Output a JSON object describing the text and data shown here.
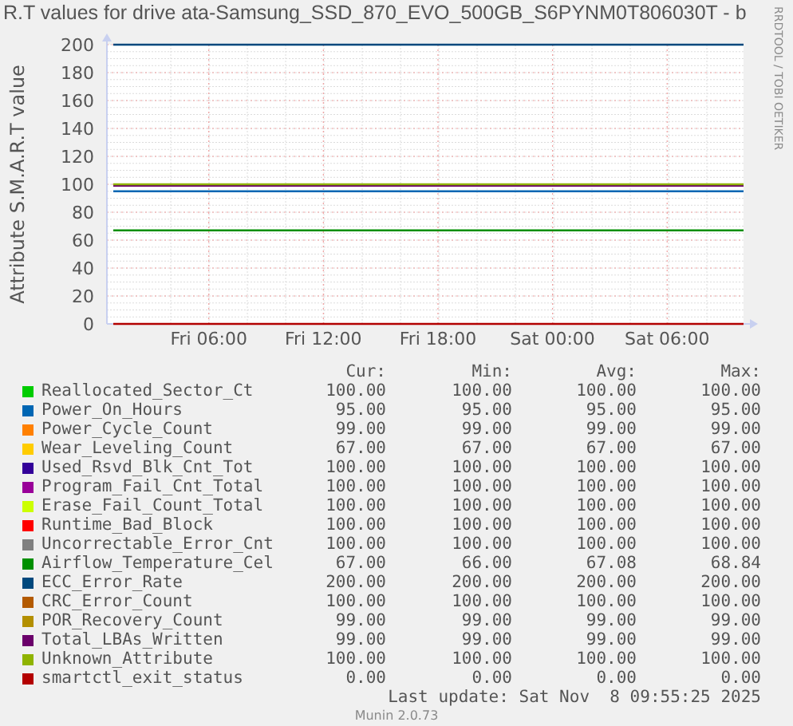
{
  "title": "R.T values for drive ata-Samsung_SSD_870_EVO_500GB_S6PYNM0T806030T - b",
  "side_text": "RRDTOOL / TOBI OETIKER",
  "chart": {
    "chart_data": {
      "type": "line",
      "ylabel": "Attribute S.M.A.R.T value",
      "categories": [
        null,
        null,
        null,
        null,
        null,
        "Fri 06:00",
        null,
        null,
        null,
        null,
        null,
        "Fri 12:00",
        null,
        null,
        null,
        null,
        null,
        "Fri 18:00",
        null,
        null,
        null,
        null,
        null,
        "Sat 00:00",
        null,
        null,
        null,
        null,
        null,
        "Sat 06:00",
        null,
        null,
        null,
        null
      ],
      "grid": true,
      "ylim": [
        0,
        200
      ],
      "yticks": [
        0,
        20,
        40,
        60,
        80,
        100,
        120,
        140,
        160,
        180,
        200
      ],
      "series": [
        {
          "name": "Reallocated_Sector_Ct",
          "color": "#00cc00",
          "values": [
            null,
            null,
            null,
            null,
            null,
            null,
            null,
            null,
            null,
            null,
            null,
            null,
            null,
            null,
            null,
            null,
            null,
            null,
            null,
            null,
            null,
            null,
            null,
            null,
            null,
            null,
            null,
            null,
            null,
            null,
            null,
            null,
            null,
            null
          ]
        },
        {
          "name": "Power_On_Hours",
          "color": "#0066b3",
          "values": [
            95,
            95,
            95,
            95,
            95,
            95,
            95,
            95,
            95,
            95,
            95,
            95,
            95,
            95,
            95,
            95,
            95,
            95,
            95,
            95,
            95,
            95,
            95,
            95,
            95,
            95,
            95,
            95,
            95,
            95,
            95,
            95,
            95,
            95
          ]
        },
        {
          "name": "Power_Cycle_Count",
          "color": "#ff8000",
          "values": [
            null,
            null,
            null,
            null,
            null,
            null,
            null,
            null,
            null,
            null,
            null,
            null,
            null,
            null,
            null,
            null,
            null,
            null,
            null,
            null,
            null,
            null,
            null,
            null,
            null,
            null,
            null,
            null,
            null,
            null,
            null,
            null,
            null,
            null
          ]
        },
        {
          "name": "Wear_Leveling_Count",
          "color": "#ffcc00",
          "values": [
            null,
            null,
            null,
            null,
            null,
            null,
            null,
            null,
            null,
            null,
            null,
            null,
            null,
            null,
            null,
            null,
            null,
            null,
            null,
            null,
            null,
            null,
            null,
            null,
            null,
            null,
            null,
            null,
            null,
            null,
            null,
            null,
            null,
            null
          ]
        },
        {
          "name": "Used_Rsvd_Blk_Cnt_Tot",
          "color": "#330099",
          "values": [
            null,
            null,
            null,
            null,
            null,
            null,
            null,
            null,
            null,
            null,
            null,
            null,
            null,
            null,
            null,
            null,
            null,
            null,
            null,
            null,
            null,
            null,
            null,
            null,
            null,
            null,
            null,
            null,
            null,
            null,
            null,
            null,
            null,
            null
          ]
        },
        {
          "name": "Program_Fail_Cnt_Total",
          "color": "#990099",
          "values": [
            null,
            null,
            null,
            null,
            null,
            null,
            null,
            null,
            null,
            null,
            null,
            null,
            null,
            null,
            null,
            null,
            null,
            null,
            null,
            null,
            null,
            null,
            null,
            null,
            null,
            null,
            null,
            null,
            null,
            null,
            null,
            null,
            null,
            null
          ]
        },
        {
          "name": "Erase_Fail_Count_Total",
          "color": "#ccff00",
          "values": [
            null,
            null,
            null,
            null,
            null,
            null,
            null,
            null,
            null,
            null,
            null,
            null,
            null,
            null,
            null,
            null,
            null,
            null,
            null,
            null,
            null,
            null,
            null,
            null,
            null,
            null,
            null,
            null,
            null,
            null,
            null,
            null,
            null,
            null
          ]
        },
        {
          "name": "Runtime_Bad_Block",
          "color": "#ff0000",
          "values": [
            null,
            null,
            null,
            null,
            null,
            null,
            null,
            null,
            null,
            null,
            null,
            null,
            null,
            null,
            null,
            null,
            null,
            null,
            null,
            null,
            null,
            null,
            null,
            null,
            null,
            null,
            null,
            null,
            null,
            null,
            null,
            null,
            null,
            null
          ]
        },
        {
          "name": "Uncorrectable_Error_Cnt",
          "color": "#808080",
          "values": [
            null,
            null,
            null,
            null,
            null,
            null,
            null,
            null,
            null,
            null,
            null,
            null,
            null,
            null,
            null,
            null,
            null,
            null,
            null,
            null,
            null,
            null,
            null,
            null,
            null,
            null,
            null,
            null,
            null,
            null,
            null,
            null,
            null,
            null
          ]
        },
        {
          "name": "Airflow_Temperature_Cel",
          "color": "#008f00",
          "values": [
            67,
            67,
            67,
            67,
            67,
            67,
            67,
            67,
            67,
            67,
            67,
            67,
            67,
            67,
            67,
            67,
            67,
            67,
            67,
            67,
            67,
            67,
            67,
            67,
            67,
            67,
            67,
            67,
            67,
            67,
            67,
            67,
            67,
            67
          ]
        },
        {
          "name": "ECC_Error_Rate",
          "color": "#00487d",
          "values": [
            200,
            200,
            200,
            200,
            200,
            200,
            200,
            200,
            200,
            200,
            200,
            200,
            200,
            200,
            200,
            200,
            200,
            200,
            200,
            200,
            200,
            200,
            200,
            200,
            200,
            200,
            200,
            200,
            200,
            200,
            200,
            200,
            200,
            200
          ]
        },
        {
          "name": "CRC_Error_Count",
          "color": "#b35a00",
          "values": [
            null,
            null,
            null,
            null,
            null,
            null,
            null,
            null,
            null,
            null,
            null,
            null,
            null,
            null,
            null,
            null,
            null,
            null,
            null,
            null,
            null,
            null,
            null,
            null,
            null,
            null,
            null,
            null,
            null,
            null,
            null,
            null,
            null,
            null
          ]
        },
        {
          "name": "POR_Recovery_Count",
          "color": "#b38f00",
          "values": [
            null,
            null,
            null,
            null,
            null,
            null,
            null,
            null,
            null,
            null,
            null,
            null,
            null,
            null,
            null,
            null,
            null,
            null,
            null,
            null,
            null,
            null,
            null,
            null,
            null,
            null,
            null,
            null,
            null,
            null,
            null,
            null,
            null,
            null
          ]
        },
        {
          "name": "Total_LBAs_Written",
          "color": "#6b006b",
          "values": [
            99,
            99,
            99,
            99,
            99,
            99,
            99,
            99,
            99,
            99,
            99,
            99,
            99,
            99,
            99,
            99,
            99,
            99,
            99,
            99,
            99,
            99,
            99,
            99,
            99,
            99,
            99,
            99,
            99,
            99,
            99,
            99,
            99,
            99
          ]
        },
        {
          "name": "Unknown_Attribute",
          "color": "#8fb300",
          "values": [
            100,
            100,
            100,
            100,
            100,
            100,
            100,
            100,
            100,
            100,
            100,
            100,
            100,
            100,
            100,
            100,
            100,
            100,
            100,
            100,
            100,
            100,
            100,
            100,
            100,
            100,
            100,
            100,
            100,
            100,
            100,
            100,
            100,
            100
          ]
        },
        {
          "name": "smartctl_exit_status",
          "color": "#b30000",
          "values": [
            0,
            0,
            0,
            0,
            0,
            0,
            0,
            0,
            0,
            0,
            0,
            0,
            0,
            0,
            0,
            0,
            0,
            0,
            0,
            0,
            0,
            0,
            0,
            0,
            0,
            0,
            0,
            0,
            0,
            0,
            0,
            0,
            0,
            0
          ]
        }
      ]
    }
  },
  "legend": {
    "columns": [
      "Cur:",
      "Min:",
      "Avg:",
      "Max:"
    ],
    "rows": [
      {
        "cur": "100.00",
        "min": "100.00",
        "avg": "100.00",
        "max": "100.00"
      },
      {
        "cur": "95.00",
        "min": "95.00",
        "avg": "95.00",
        "max": "95.00"
      },
      {
        "cur": "99.00",
        "min": "99.00",
        "avg": "99.00",
        "max": "99.00"
      },
      {
        "cur": "67.00",
        "min": "67.00",
        "avg": "67.00",
        "max": "67.00"
      },
      {
        "cur": "100.00",
        "min": "100.00",
        "avg": "100.00",
        "max": "100.00"
      },
      {
        "cur": "100.00",
        "min": "100.00",
        "avg": "100.00",
        "max": "100.00"
      },
      {
        "cur": "100.00",
        "min": "100.00",
        "avg": "100.00",
        "max": "100.00"
      },
      {
        "cur": "100.00",
        "min": "100.00",
        "avg": "100.00",
        "max": "100.00"
      },
      {
        "cur": "100.00",
        "min": "100.00",
        "avg": "100.00",
        "max": "100.00"
      },
      {
        "cur": "67.00",
        "min": "66.00",
        "avg": "67.08",
        "max": "68.84"
      },
      {
        "cur": "200.00",
        "min": "200.00",
        "avg": "200.00",
        "max": "200.00"
      },
      {
        "cur": "100.00",
        "min": "100.00",
        "avg": "100.00",
        "max": "100.00"
      },
      {
        "cur": "99.00",
        "min": "99.00",
        "avg": "99.00",
        "max": "99.00"
      },
      {
        "cur": "99.00",
        "min": "99.00",
        "avg": "99.00",
        "max": "99.00"
      },
      {
        "cur": "100.00",
        "min": "100.00",
        "avg": "100.00",
        "max": "100.00"
      },
      {
        "cur": "0.00",
        "min": "0.00",
        "avg": "0.00",
        "max": "0.00"
      }
    ]
  },
  "last_update": "Last update: Sat Nov  8 09:55:25 2025",
  "footer": "Munin 2.0.73"
}
